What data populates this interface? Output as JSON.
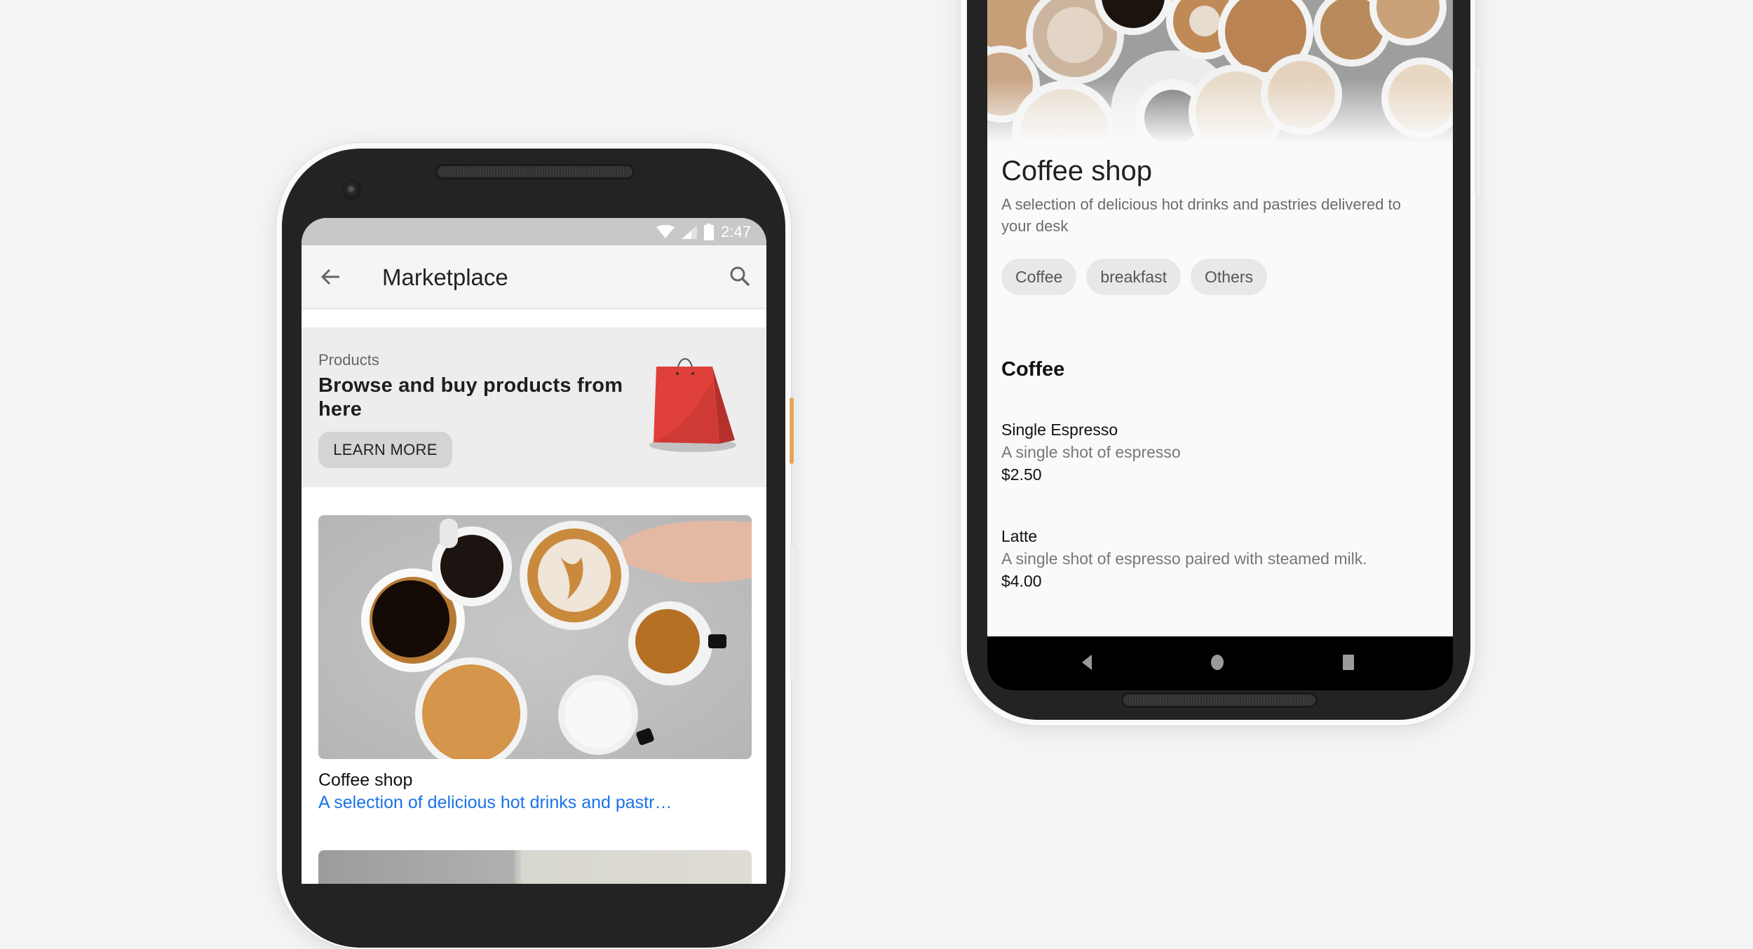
{
  "left_phone": {
    "status_bar": {
      "time": "2:47",
      "icons": [
        "wifi-icon",
        "signal-icon",
        "battery-icon"
      ]
    },
    "app_bar": {
      "title": "Marketplace",
      "back_icon": "arrow-back-icon",
      "search_icon": "search-icon"
    },
    "banner": {
      "eyebrow": "Products",
      "headline": "Browse and buy products from here",
      "button_label": "LEARN MORE",
      "image": "shopping-bag-icon"
    },
    "card": {
      "title": "Coffee shop",
      "subtitle": "A selection of delicious hot drinks and pastr…",
      "link_color": "#1a73e8"
    }
  },
  "right_phone": {
    "shop": {
      "title": "Coffee shop",
      "description": "A selection of delicious hot drinks and pastries delivered to your desk"
    },
    "chips": [
      "Coffee",
      "breakfast",
      "Others"
    ],
    "section_title": "Coffee",
    "menu": [
      {
        "name": "Single Espresso",
        "description": "A single shot of espresso",
        "price": "$2.50"
      },
      {
        "name": "Latte",
        "description": "A single shot of espresso paired with steamed milk.",
        "price": "$4.00"
      }
    ],
    "nav": {
      "back": "nav-back-icon",
      "home": "nav-home-icon",
      "recents": "nav-recents-icon"
    }
  },
  "colors": {
    "background": "#f3f4f6",
    "accent_link": "#1a73e8",
    "power_button": "#e7a55a",
    "bag_red": "#e0403a"
  }
}
